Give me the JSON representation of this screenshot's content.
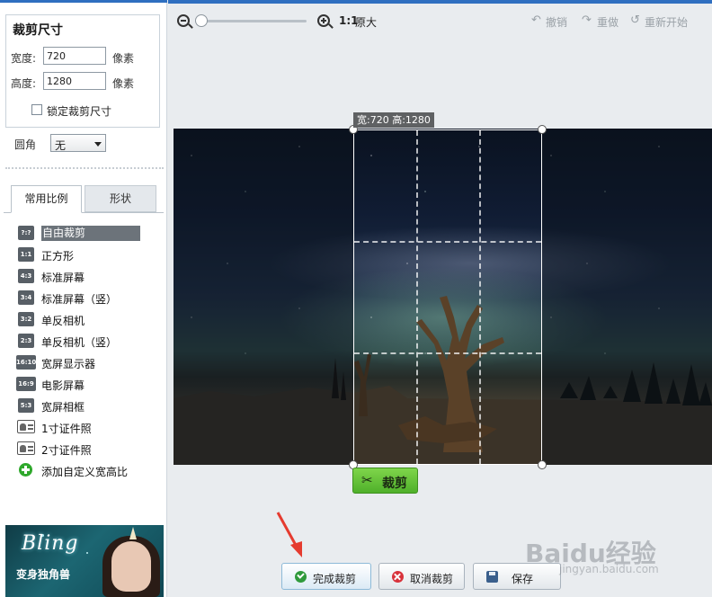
{
  "left_panel": {
    "size_box": {
      "title": "裁剪尺寸",
      "width_label": "宽度:",
      "width_value": "720",
      "height_label": "高度:",
      "height_value": "1280",
      "unit": "像素",
      "lock_label": "锁定裁剪尺寸",
      "lock_checked": false
    },
    "corner": {
      "label": "圆角",
      "value": "无"
    },
    "tabs": [
      {
        "label": "常用比例",
        "active": true
      },
      {
        "label": "形状",
        "active": false
      }
    ],
    "ratios": [
      {
        "icon": "?:?",
        "label": "自由裁剪",
        "selected": true
      },
      {
        "icon": "1:1",
        "label": "正方形"
      },
      {
        "icon": "4:3",
        "label": "标准屏幕"
      },
      {
        "icon": "3:4",
        "label": "标准屏幕（竖）"
      },
      {
        "icon": "3:2",
        "label": "单反相机"
      },
      {
        "icon": "2:3",
        "label": "单反相机（竖）"
      },
      {
        "icon": "16:10",
        "label": "宽屏显示器"
      },
      {
        "icon": "16:9",
        "label": "电影屏幕"
      },
      {
        "icon": "5:3",
        "label": "宽屏相框"
      },
      {
        "icon": "id-card-icon",
        "label": "1寸证件照"
      },
      {
        "icon": "id-card-icon",
        "label": "2寸证件照"
      },
      {
        "icon": "plus-circle-icon",
        "label": "添加自定义宽高比"
      }
    ],
    "ad": {
      "title": "Bling",
      "subtitle": "变身独角兽"
    }
  },
  "toolbar": {
    "original_ratio": "1:1",
    "original_label": "原大",
    "undo_label": "撤销",
    "redo_label": "重做",
    "restart_label": "重新开始",
    "zoom_level": 0.0
  },
  "canvas": {
    "crop_size_tag": "宽:720 高:1280",
    "crop_button_label": "裁剪"
  },
  "bottom": {
    "done_label": "完成裁剪",
    "cancel_label": "取消裁剪",
    "save_label": "保存"
  },
  "watermark": {
    "main": "Baidu经验",
    "sub": "jingyan.baidu.com"
  },
  "colors": {
    "accent_blue": "#2f6fc0",
    "crop_green": "#5cbf2a",
    "arrow_red": "#e53b2f"
  }
}
